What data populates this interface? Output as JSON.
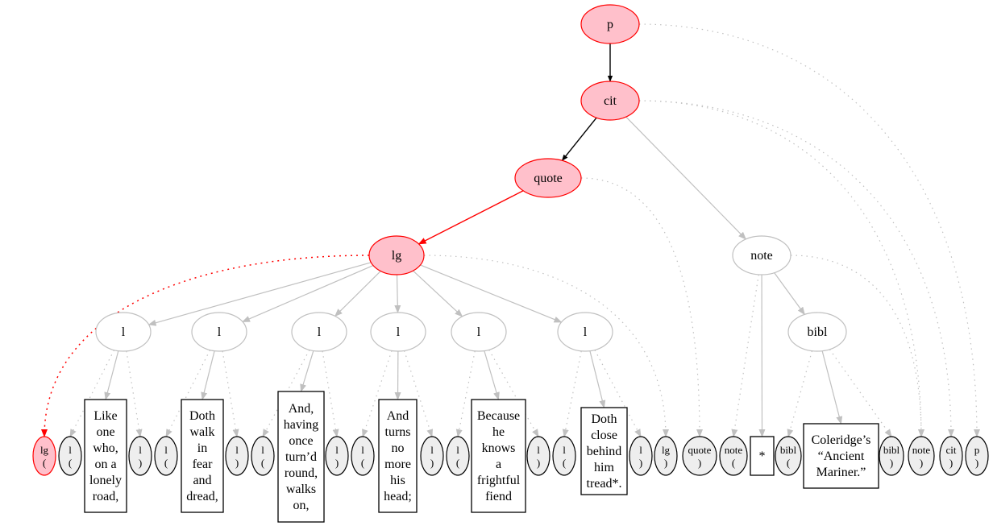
{
  "colors": {
    "highlight_fill": "#ffc0cb",
    "highlight_stroke": "#ff0000",
    "tree_stroke": "#c0c0c0",
    "leaf_fill": "#eeeeee",
    "leaf_stroke": "#000000",
    "text_box_stroke": "#000000",
    "path_edge": "#000000",
    "active_edge": "#ff0000",
    "gray_edge": "#c0c0c0"
  },
  "tree_nodes": [
    {
      "id": "p",
      "label": "p",
      "highlighted": true
    },
    {
      "id": "cit",
      "label": "cit",
      "highlighted": true
    },
    {
      "id": "quote",
      "label": "quote",
      "highlighted": true
    },
    {
      "id": "lg",
      "label": "lg",
      "highlighted": true
    },
    {
      "id": "l1",
      "label": "l"
    },
    {
      "id": "l2",
      "label": "l"
    },
    {
      "id": "l3",
      "label": "l"
    },
    {
      "id": "l4",
      "label": "l"
    },
    {
      "id": "l5",
      "label": "l"
    },
    {
      "id": "l6",
      "label": "l"
    },
    {
      "id": "note",
      "label": "note"
    },
    {
      "id": "bibl",
      "label": "bibl"
    }
  ],
  "bottom_row": [
    {
      "id": "lg_open",
      "type": "marker",
      "tag": "lg",
      "bracket": "(",
      "highlighted": true
    },
    {
      "id": "l1_open",
      "type": "marker",
      "tag": "l",
      "bracket": "("
    },
    {
      "id": "t1",
      "type": "text",
      "lines": [
        "Like",
        "one",
        "who,",
        "on a",
        "lonely",
        "road,"
      ]
    },
    {
      "id": "l1_close",
      "type": "marker",
      "tag": "l",
      "bracket": ")"
    },
    {
      "id": "l2_open",
      "type": "marker",
      "tag": "l",
      "bracket": "("
    },
    {
      "id": "t2",
      "type": "text",
      "lines": [
        "Doth",
        "walk",
        "in",
        "fear",
        "and",
        "dread,"
      ]
    },
    {
      "id": "l2_close",
      "type": "marker",
      "tag": "l",
      "bracket": ")"
    },
    {
      "id": "l3_open",
      "type": "marker",
      "tag": "l",
      "bracket": "("
    },
    {
      "id": "t3",
      "type": "text",
      "lines": [
        "And,",
        "having",
        "once",
        "turn’d",
        "round,",
        "walks",
        "on,"
      ]
    },
    {
      "id": "l3_close",
      "type": "marker",
      "tag": "l",
      "bracket": ")"
    },
    {
      "id": "l4_open",
      "type": "marker",
      "tag": "l",
      "bracket": "("
    },
    {
      "id": "t4",
      "type": "text",
      "lines": [
        "And",
        "turns",
        "no",
        "more",
        "his",
        "head;"
      ]
    },
    {
      "id": "l4_close",
      "type": "marker",
      "tag": "l",
      "bracket": ")"
    },
    {
      "id": "l5_open",
      "type": "marker",
      "tag": "l",
      "bracket": "("
    },
    {
      "id": "t5",
      "type": "text",
      "lines": [
        "Because",
        "he",
        "knows",
        "a",
        "frightful",
        "fiend"
      ]
    },
    {
      "id": "l5_close",
      "type": "marker",
      "tag": "l",
      "bracket": ")"
    },
    {
      "id": "l6_open",
      "type": "marker",
      "tag": "l",
      "bracket": "("
    },
    {
      "id": "t6",
      "type": "text",
      "lines": [
        "Doth",
        "close",
        "behind",
        "him",
        "tread*."
      ]
    },
    {
      "id": "l6_close",
      "type": "marker",
      "tag": "l",
      "bracket": ")"
    },
    {
      "id": "lg_close",
      "type": "marker",
      "tag": "lg",
      "bracket": ")"
    },
    {
      "id": "quote_close",
      "type": "marker",
      "tag": "quote",
      "bracket": ")"
    },
    {
      "id": "note_open",
      "type": "marker",
      "tag": "note",
      "bracket": "("
    },
    {
      "id": "t7",
      "type": "text",
      "lines": [
        "*"
      ]
    },
    {
      "id": "bibl_open",
      "type": "marker",
      "tag": "bibl",
      "bracket": "("
    },
    {
      "id": "t8",
      "type": "text",
      "lines": [
        "Coleridge’s",
        "“Ancient",
        "Mariner.”"
      ]
    },
    {
      "id": "bibl_close",
      "type": "marker",
      "tag": "bibl",
      "bracket": ")"
    },
    {
      "id": "note_close",
      "type": "marker",
      "tag": "note",
      "bracket": ")"
    },
    {
      "id": "cit_close",
      "type": "marker",
      "tag": "cit",
      "bracket": ")"
    },
    {
      "id": "p_close",
      "type": "marker",
      "tag": "p",
      "bracket": ")"
    }
  ],
  "edges": [
    {
      "from": "p",
      "to": "cit",
      "style": "path"
    },
    {
      "from": "cit",
      "to": "quote",
      "style": "path"
    },
    {
      "from": "quote",
      "to": "lg",
      "style": "active"
    },
    {
      "from": "cit",
      "to": "note",
      "style": "solid"
    },
    {
      "from": "lg",
      "to": "l1",
      "style": "solid"
    },
    {
      "from": "lg",
      "to": "l2",
      "style": "solid"
    },
    {
      "from": "lg",
      "to": "l3",
      "style": "solid"
    },
    {
      "from": "lg",
      "to": "l4",
      "style": "solid"
    },
    {
      "from": "lg",
      "to": "l5",
      "style": "solid"
    },
    {
      "from": "lg",
      "to": "l6",
      "style": "solid"
    },
    {
      "from": "note",
      "to": "bibl",
      "style": "solid"
    },
    {
      "from": "l1",
      "to": "t1",
      "style": "solid"
    },
    {
      "from": "l2",
      "to": "t2",
      "style": "solid"
    },
    {
      "from": "l3",
      "to": "t3",
      "style": "solid"
    },
    {
      "from": "l4",
      "to": "t4",
      "style": "solid"
    },
    {
      "from": "l5",
      "to": "t5",
      "style": "solid"
    },
    {
      "from": "l6",
      "to": "t6",
      "style": "solid"
    },
    {
      "from": "note",
      "to": "t7",
      "style": "solid"
    },
    {
      "from": "bibl",
      "to": "t8",
      "style": "solid"
    },
    {
      "from": "lg",
      "to": "lg_open",
      "style": "active-dotted"
    },
    {
      "from": "lg",
      "to": "lg_close",
      "style": "dotted"
    },
    {
      "from": "quote",
      "to": "quote_close",
      "style": "dotted"
    },
    {
      "from": "cit",
      "to": "note_close",
      "style": "dotted"
    },
    {
      "from": "cit",
      "to": "cit_close",
      "style": "dotted"
    },
    {
      "from": "p",
      "to": "p_close",
      "style": "dotted"
    },
    {
      "from": "l1",
      "to": "l1_open",
      "style": "dotted"
    },
    {
      "from": "l1",
      "to": "l1_close",
      "style": "dotted"
    },
    {
      "from": "l2",
      "to": "l2_open",
      "style": "dotted"
    },
    {
      "from": "l2",
      "to": "l2_close",
      "style": "dotted"
    },
    {
      "from": "l3",
      "to": "l3_open",
      "style": "dotted"
    },
    {
      "from": "l3",
      "to": "l3_close",
      "style": "dotted"
    },
    {
      "from": "l4",
      "to": "l4_open",
      "style": "dotted"
    },
    {
      "from": "l4",
      "to": "l4_close",
      "style": "dotted"
    },
    {
      "from": "l5",
      "to": "l5_open",
      "style": "dotted"
    },
    {
      "from": "l5",
      "to": "l5_close",
      "style": "dotted"
    },
    {
      "from": "l6",
      "to": "l6_open",
      "style": "dotted"
    },
    {
      "from": "l6",
      "to": "l6_close",
      "style": "dotted"
    },
    {
      "from": "note",
      "to": "note_open",
      "style": "dotted"
    },
    {
      "from": "note",
      "to": "note_close",
      "style": "dotted"
    },
    {
      "from": "bibl",
      "to": "bibl_open",
      "style": "dotted"
    },
    {
      "from": "bibl",
      "to": "bibl_close",
      "style": "dotted"
    }
  ]
}
